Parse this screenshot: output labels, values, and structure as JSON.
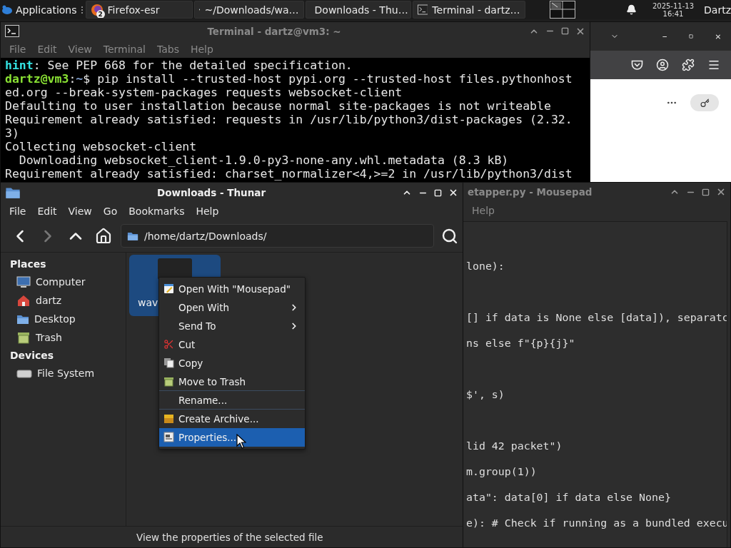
{
  "taskbar": {
    "menu_label": "Applications",
    "tasks": [
      {
        "label": "Firefox-esr",
        "badge": "2"
      },
      {
        "label": "~/Downloads/wa…"
      },
      {
        "label": "Downloads - Thu…"
      },
      {
        "label": "Terminal - dartz…"
      }
    ],
    "date": "2025-11-13",
    "time": "16:41",
    "user": "Dartz"
  },
  "terminal": {
    "title": "Terminal - dartz@vm3: ~",
    "active": false,
    "menu": [
      "File",
      "Edit",
      "View",
      "Terminal",
      "Tabs",
      "Help"
    ],
    "lines": [
      [
        {
          "kind": "hint",
          "text": "hint"
        },
        {
          "kind": "plain",
          "text": ": See PEP 668 for the detailed specification."
        }
      ],
      [
        {
          "kind": "user",
          "text": "dartz@vm3"
        },
        {
          "kind": "plain",
          "text": ":"
        },
        {
          "kind": "path",
          "text": "~"
        },
        {
          "kind": "plain",
          "text": "$ pip install --trusted-host pypi.org --trusted-host files.pythonhost"
        }
      ],
      [
        {
          "kind": "plain",
          "text": "ed.org --break-system-packages requests websocket-client"
        }
      ],
      [
        {
          "kind": "plain",
          "text": "Defaulting to user installation because normal site-packages is not writeable"
        }
      ],
      [
        {
          "kind": "plain",
          "text": "Requirement already satisfied: requests in /usr/lib/python3/dist-packages (2.32."
        }
      ],
      [
        {
          "kind": "plain",
          "text": "3)"
        }
      ],
      [
        {
          "kind": "plain",
          "text": "Collecting websocket-client"
        }
      ],
      [
        {
          "kind": "plain",
          "text": "  Downloading websocket_client-1.9.0-py3-none-any.whl.metadata (8.3 kB)"
        }
      ],
      [
        {
          "kind": "plain",
          "text": "Requirement already satisfied: charset_normalizer<4,>=2 in /usr/lib/python3/dist"
        }
      ]
    ]
  },
  "mousepad": {
    "title": "etapper.py - Mousepad",
    "active": false,
    "menu": [
      "Help"
    ],
    "lines": [
      {
        "kind": "blank"
      },
      {
        "kind": "code",
        "text": "lone):"
      },
      {
        "kind": "blank"
      },
      {
        "kind": "code",
        "text": "[] if data is None else [data]), separatc"
      },
      {
        "kind": "code",
        "text": "ns else f\"{p}{j}\""
      },
      {
        "kind": "blank"
      },
      {
        "kind": "code",
        "text": "$', s)"
      },
      {
        "kind": "blank"
      },
      {
        "kind": "code",
        "text": "lid 42 packet\")"
      },
      {
        "kind": "code",
        "text": "m.group(1))"
      },
      {
        "kind": "code",
        "text": "ata\": data[0] if data else None}"
      },
      {
        "kind": "code",
        "text": "e): # Check if running as a bundled execu"
      }
    ]
  },
  "thunar": {
    "title": "Downloads - Thunar",
    "active": true,
    "menu": [
      "File",
      "Edit",
      "View",
      "Go",
      "Bookmarks",
      "Help"
    ],
    "nav_buttons": [
      {
        "disabled": false
      },
      {
        "disabled": true
      },
      {
        "disabled": false
      },
      {
        "disabled": false
      }
    ],
    "location": "/home/dartz/Downloads/",
    "sidebar": [
      {
        "title": "Places",
        "items": [
          {
            "label": "Computer"
          },
          {
            "label": "dartz"
          },
          {
            "label": "Desktop"
          },
          {
            "label": "Trash"
          }
        ]
      },
      {
        "title": "Devices",
        "items": [
          {
            "label": "File System"
          }
        ]
      }
    ],
    "files": [
      {
        "label": "wav",
        "selected": true
      }
    ],
    "status": "View the properties of the selected file"
  },
  "context_menu": [
    {
      "label": "Open With \"Mousepad\"",
      "submenu": false,
      "selected": false,
      "separator_after": false
    },
    {
      "label": "Open With",
      "submenu": true,
      "selected": false,
      "separator_after": false
    },
    {
      "label": "Send To",
      "submenu": true,
      "selected": false,
      "separator_after": false
    },
    {
      "label": "Cut",
      "submenu": false,
      "selected": false,
      "separator_after": false
    },
    {
      "label": "Copy",
      "submenu": false,
      "selected": false,
      "separator_after": false
    },
    {
      "label": "Move to Trash",
      "submenu": false,
      "selected": false,
      "separator_after": true
    },
    {
      "label": "Rename...",
      "submenu": false,
      "selected": false,
      "separator_after": true
    },
    {
      "label": "Create Archive...",
      "submenu": false,
      "selected": false,
      "separator_after": false
    },
    {
      "label": "Properties...",
      "submenu": false,
      "selected": true,
      "separator_after": false
    }
  ]
}
